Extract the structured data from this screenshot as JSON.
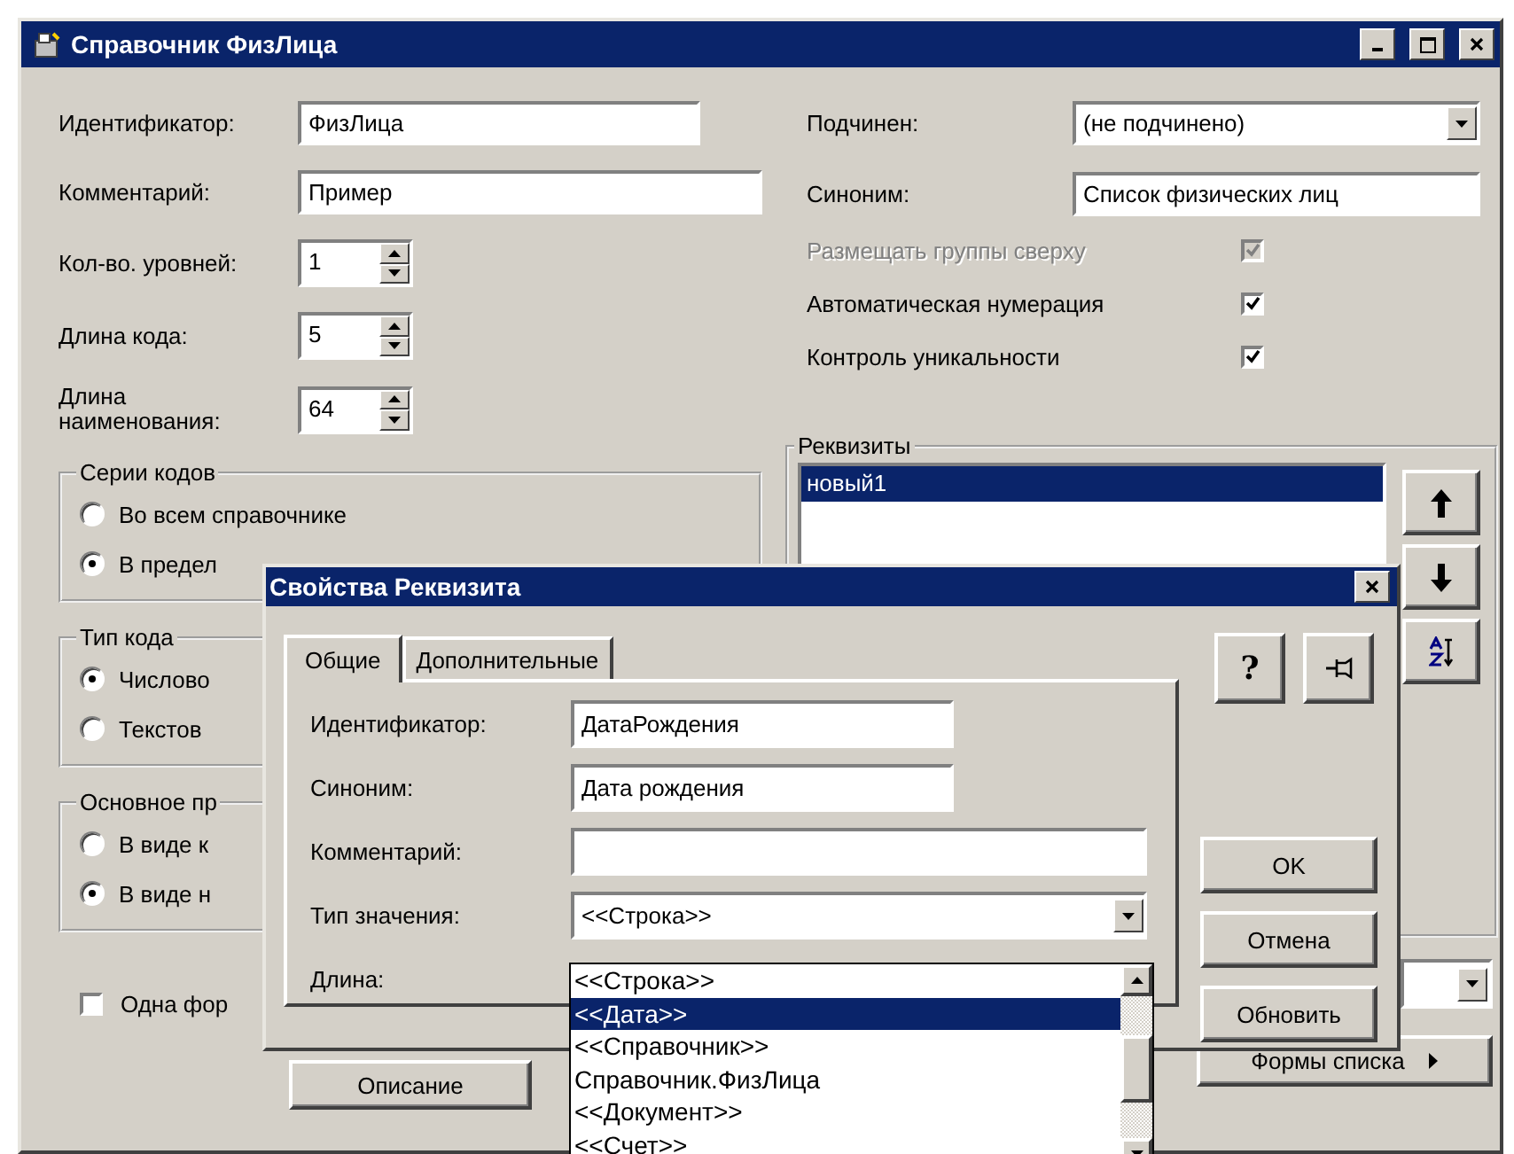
{
  "window": {
    "title": "Справочник ФизЛица"
  },
  "left_fields": [
    {
      "kind": "text",
      "label": "Идентификатор:",
      "value": "ФизЛица"
    },
    {
      "kind": "wide",
      "label": "Комментарий:",
      "value": "Пример"
    },
    {
      "kind": "spin",
      "label": "Кол-во. уровней:",
      "value": "1"
    },
    {
      "kind": "spin",
      "label": "Длина кода:",
      "value": "5"
    },
    {
      "kind": "spin",
      "label": "Длина наименования:",
      "value": "64"
    }
  ],
  "groups": [
    {
      "title": "Серии кодов",
      "options": [
        {
          "label": "Во всем справочнике",
          "selected": false
        },
        {
          "label": "В предел",
          "selected": true
        }
      ]
    },
    {
      "title": "Тип кода",
      "options": [
        {
          "label": "Числово",
          "selected": true
        },
        {
          "label": "Текстов",
          "selected": false
        }
      ]
    },
    {
      "title": "Основное пр",
      "options": [
        {
          "label": "В виде к",
          "selected": false
        },
        {
          "label": "В виде н",
          "selected": true
        }
      ]
    }
  ],
  "single_form": {
    "label": "Одна фор",
    "checked": false
  },
  "description_button": "Описание",
  "right_fields": [
    {
      "kind": "combo",
      "label": "Подчинен:",
      "value": "(не подчинено)"
    },
    {
      "kind": "text",
      "label": "Синоним:",
      "value": "Список физических лиц"
    }
  ],
  "flags": [
    {
      "label": "Размещать группы сверху",
      "checked": true,
      "disabled": true
    },
    {
      "label": "Автоматическая нумерация",
      "checked": true,
      "disabled": false
    },
    {
      "label": "Контроль уникальности",
      "checked": true,
      "disabled": false
    }
  ],
  "attributes": {
    "title": "Реквизиты",
    "items": [
      {
        "label": "новый1",
        "selected": true
      }
    ]
  },
  "list_forms_button": "Формы списка",
  "dialog": {
    "title": "Свойства Реквизита",
    "tabs": [
      {
        "label": "Общие",
        "selected": true
      },
      {
        "label": "Дополнительные",
        "selected": false
      }
    ],
    "help_button": "?",
    "fields": [
      {
        "kind": "text",
        "label": "Идентификатор:",
        "value": "ДатаРождения"
      },
      {
        "kind": "text",
        "label": "Синоним:",
        "value": "Дата рождения"
      },
      {
        "kind": "wide",
        "label": "Комментарий:"
      },
      {
        "kind": "combo",
        "label": "Тип значения:",
        "value": "<<Строка>>"
      },
      {
        "kind": "label",
        "label": "Длина:"
      }
    ],
    "buttons": [
      "OK",
      "Отмена",
      "Обновить"
    ],
    "dropdown": {
      "items": [
        {
          "label": "<<Строка>>",
          "selected": false
        },
        {
          "label": "<<Дата>>",
          "selected": true
        },
        {
          "label": "<<Справочник>>",
          "selected": false
        },
        {
          "label": "Справочник.ФизЛица",
          "selected": false
        },
        {
          "label": "<<Документ>>",
          "selected": false
        },
        {
          "label": "<<Счет>>",
          "selected": false
        }
      ]
    }
  }
}
